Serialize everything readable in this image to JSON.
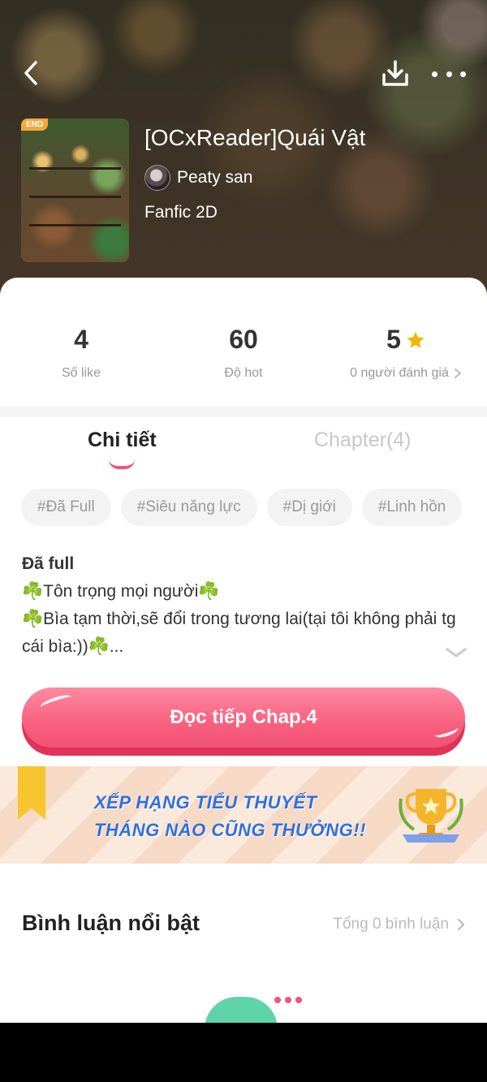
{
  "header": {
    "badge": "END",
    "title": "[OCxReader]Quái Vật",
    "author": "Peaty san",
    "genre": "Fanfic 2D"
  },
  "stats": [
    {
      "value": "4",
      "label": "Số like"
    },
    {
      "value": "60",
      "label": "Độ hot"
    },
    {
      "value": "5",
      "label": "0 người đánh giá"
    }
  ],
  "tabs": {
    "details": "Chi tiết",
    "chapters": "Chapter(4)"
  },
  "tags": [
    "#Đã Full",
    "#Siêu năng lực",
    "#Dị giới",
    "#Linh hồn"
  ],
  "description": {
    "status": "Đã full",
    "line1": "☘️Tôn trọng mọi người☘️",
    "line2": "☘️Bìa tạm thời,sẽ đổi trong tương lai(tại tôi không phải tg cái bìa:))☘️..."
  },
  "read_button": "Đọc tiếp Chap.4",
  "banner": {
    "line1": "XẾP HẠNG TIỂU THUYẾT",
    "line2": "THÁNG NÀO CŨNG THƯỞNG!!"
  },
  "comments": {
    "title": "Bình luận nổi bật",
    "count": "Tổng 0 bình luận"
  },
  "colors": {
    "accent": "#f25274",
    "star": "#f7b500",
    "banner_text": "#2f6fe0"
  }
}
